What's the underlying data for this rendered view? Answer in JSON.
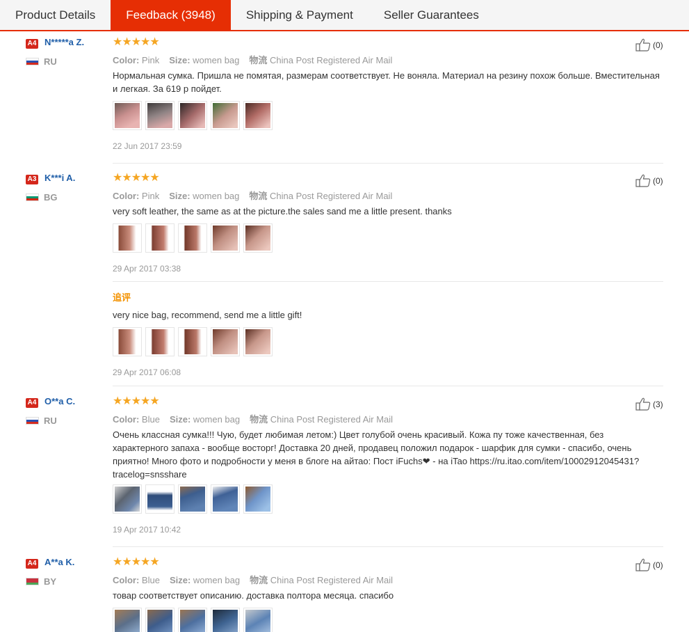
{
  "tabs": [
    {
      "label": "Product Details"
    },
    {
      "label": "Feedback (3948)"
    },
    {
      "label": "Shipping & Payment"
    },
    {
      "label": "Seller Guarantees"
    }
  ],
  "labels": {
    "color": "Color:",
    "size": "Size:",
    "logistics": "物流",
    "followup": "追评"
  },
  "stars": "★★★★★",
  "reviews": [
    {
      "level": "A4",
      "name": "N*****a Z.",
      "country": "RU",
      "color": "Pink",
      "size": "women bag",
      "shipping": "China Post Registered Air Mail",
      "text": "Нормальная сумка. Пришла не помятая, размерам соответствует. Не воняла. Материал на резину похож больше. Вместительная и легкая. За 619 р пойдет.",
      "date": "22 Jun 2017 23:59",
      "helpful": "(0)"
    },
    {
      "level": "A3",
      "name": "K***i A.",
      "country": "BG",
      "color": "Pink",
      "size": "women bag",
      "shipping": "China Post Registered Air Mail",
      "text": "very soft leather, the same as at the picture.the sales sand me a little present. thanks",
      "date": "29 Apr 2017 03:38",
      "followup_text": "very nice bag, recommend, send me a little gift!",
      "followup_date": "29 Apr 2017 06:08",
      "helpful": "(0)"
    },
    {
      "level": "A4",
      "name": "O**a C.",
      "country": "RU",
      "color": "Blue",
      "size": "women bag",
      "shipping": "China Post Registered Air Mail",
      "text": "Очень классная сумка!!! Чую, будет любимая летом:) Цвет голубой очень красивый. Кожа пу тоже качественная, без характерного запаха - вообще восторг! Доставка 20 дней, продавец положил подарок - шарфик для сумки - спасибо, очень приятно! Много фото и подробности у меня в блоге на айтао: Пост iFuchs❤ - на iTao https://ru.itao.com/item/10002912045431?tracelog=snsshare",
      "date": "19 Apr 2017 10:42",
      "helpful": "(3)"
    },
    {
      "level": "A4",
      "name": "A**a K.",
      "country": "BY",
      "color": "Blue",
      "size": "women bag",
      "shipping": "China Post Registered Air Mail",
      "text": "товар соответствует описанию. доставка полтора месяца. спасибо",
      "helpful": "(0)"
    }
  ],
  "colors": {
    "accent": "#e62e04",
    "username": "#1f5ea8",
    "star": "#f5a623",
    "followup": "#f39200",
    "level_badge": "#d4271b"
  }
}
